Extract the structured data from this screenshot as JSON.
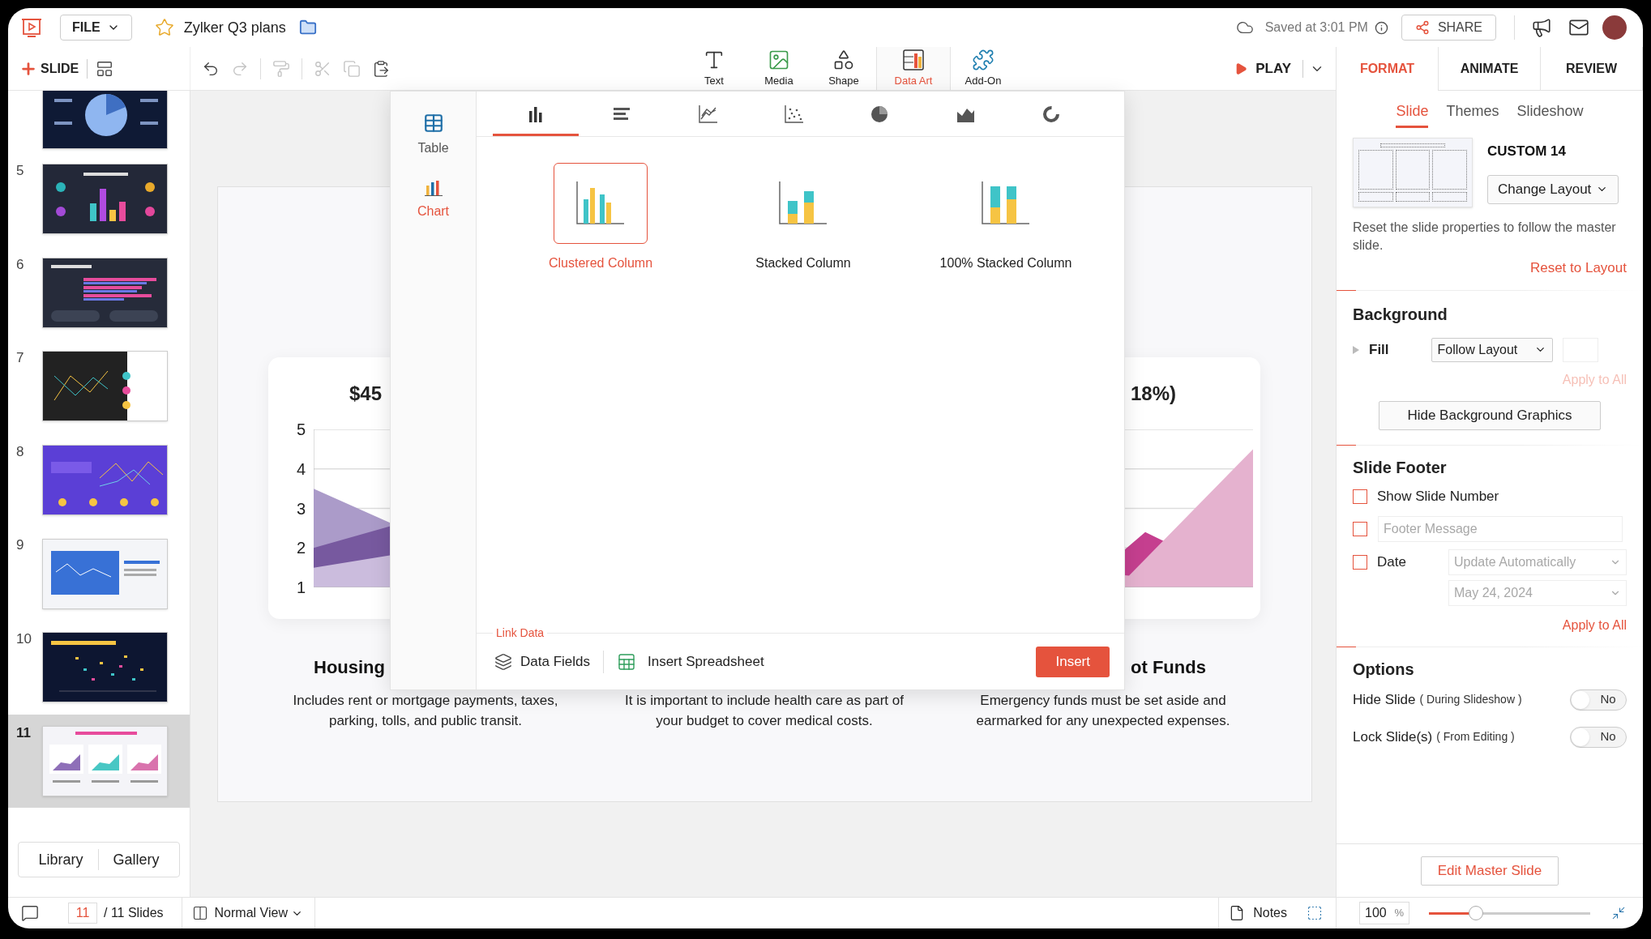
{
  "app_bar": {
    "file_menu": "FILE",
    "favorite": false,
    "document_title": "Zylker Q3 plans",
    "save_status": "Saved at 3:01 PM",
    "share_button": "SHARE"
  },
  "toolbar": {
    "new_slide": "SLIDE",
    "actions": [
      {
        "kind": "layout",
        "disabled": false
      },
      {
        "kind": "undo",
        "disabled": false
      },
      {
        "kind": "redo",
        "disabled": true
      },
      {
        "kind": "paint",
        "disabled": true
      },
      {
        "kind": "cut",
        "disabled": true
      },
      {
        "kind": "copy",
        "disabled": true
      },
      {
        "kind": "paste",
        "disabled": false
      }
    ],
    "insert_tools": [
      {
        "kind": "text",
        "label": "Text",
        "selected": false
      },
      {
        "kind": "media",
        "label": "Media",
        "selected": false
      },
      {
        "kind": "shape",
        "label": "Shape",
        "selected": false
      },
      {
        "kind": "dataart",
        "label": "Data Art",
        "selected": true
      },
      {
        "kind": "addon",
        "label": "Add-On",
        "selected": false
      }
    ],
    "play": "PLAY"
  },
  "panel_tabs": [
    {
      "label": "FORMAT",
      "selected": true
    },
    {
      "label": "ANIMATE",
      "selected": false
    },
    {
      "label": "REVIEW",
      "selected": false
    }
  ],
  "slides_panel": {
    "thumbnails": [
      {
        "kind": "pie",
        "selected": false
      },
      {
        "number": "5",
        "kind": "columns",
        "selected": false
      },
      {
        "number": "6",
        "kind": "bars",
        "selected": false
      },
      {
        "number": "7",
        "kind": "split",
        "selected": false
      },
      {
        "number": "8",
        "kind": "purple",
        "selected": false
      },
      {
        "number": "9",
        "kind": "bluecard",
        "selected": false
      },
      {
        "number": "10",
        "kind": "scatter",
        "selected": false
      },
      {
        "number": "11",
        "kind": "areas",
        "selected": true
      }
    ],
    "buttons": [
      "Library",
      "Gallery"
    ]
  },
  "slide": {
    "cards": [
      {
        "title": "$45",
        "axis_labels": [
          "5",
          "4",
          "3",
          "2",
          "1"
        ],
        "heading": "Housing",
        "description": "Includes rent or mortgage payments, taxes, parking, tolls, and public transit."
      },
      {
        "description": "It is important to include health care as part of your budget to cover medical costs."
      },
      {
        "title": "18%)",
        "heading": "ot Funds",
        "description": "Emergency funds must be set aside and earmarked for any unexpected expenses."
      }
    ]
  },
  "data_art_dialog": {
    "categories": [
      {
        "kind": "table",
        "label": "Table",
        "selected": false
      },
      {
        "kind": "chart",
        "label": "Chart",
        "selected": true
      }
    ],
    "chart_types": [
      {
        "kind": "column",
        "selected": true
      },
      {
        "kind": "bar",
        "selected": false
      },
      {
        "kind": "line",
        "selected": false
      },
      {
        "kind": "scatter",
        "selected": false
      },
      {
        "kind": "pie",
        "selected": false
      },
      {
        "kind": "area",
        "selected": false
      },
      {
        "kind": "donut",
        "selected": false
      }
    ],
    "variants": [
      {
        "kind": "clustered",
        "label": "Clustered Column",
        "selected": true
      },
      {
        "kind": "stacked",
        "label": "Stacked Column",
        "selected": false
      },
      {
        "kind": "percent",
        "label": "100% Stacked Column",
        "selected": false
      }
    ],
    "link_data_label": "Link Data",
    "data_fields": "Data Fields",
    "insert_spreadsheet": "Insert Spreadsheet",
    "insert_button": "Insert"
  },
  "format_panel": {
    "sub_tabs": [
      {
        "label": "Slide",
        "selected": true
      },
      {
        "label": "Themes",
        "selected": false
      },
      {
        "label": "Slideshow",
        "selected": false
      }
    ],
    "layout_name": "CUSTOM 14",
    "change_layout": "Change Layout",
    "reset_hint": "Reset the slide properties to follow the master slide.",
    "reset_link": "Reset to Layout",
    "background": {
      "heading": "Background",
      "fill_label": "Fill",
      "fill_value": "Follow Layout",
      "apply_all": {
        "label": "Apply to All",
        "disabled": true
      },
      "hide_graphics": "Hide Background Graphics"
    },
    "footer": {
      "heading": "Slide Footer",
      "options": [
        {
          "kind": "checkbox",
          "label": "Show Slide Number",
          "checked": false
        },
        {
          "kind": "field",
          "placeholder": "Footer Message",
          "checked": false
        },
        {
          "kind": "date",
          "label": "Date",
          "checked": false,
          "format": "Update Automatically",
          "date": "May 24, 2024"
        }
      ],
      "apply_all": {
        "label": "Apply to All",
        "disabled": false
      }
    },
    "options": {
      "heading": "Options",
      "toggles": [
        {
          "label": "Hide Slide",
          "note": "( During Slideshow )",
          "on": false,
          "state_text": "No"
        },
        {
          "label": "Lock Slide(s)",
          "note": "( From Editing )",
          "on": false,
          "state_text": "No"
        }
      ]
    },
    "edit_master": "Edit Master Slide"
  },
  "status_bar": {
    "current_slide": "11",
    "total": "/ 11 Slides",
    "view": "Normal View",
    "notes": "Notes",
    "zoom": "100",
    "zoom_unit": "%",
    "zoom_slider": {
      "level": 0.29
    }
  }
}
